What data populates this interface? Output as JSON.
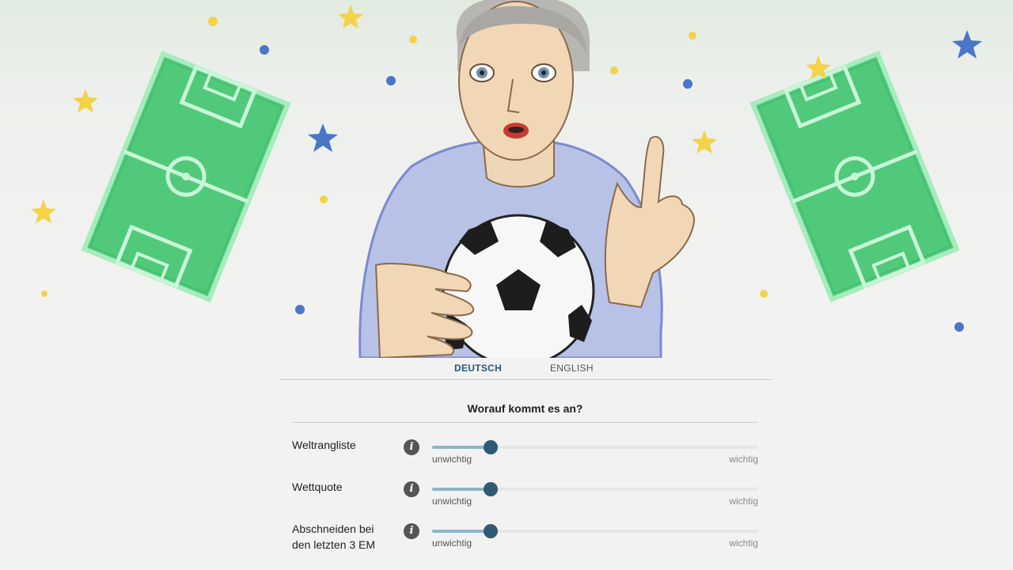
{
  "language_tabs": [
    {
      "label": "DEUTSCH",
      "active": true
    },
    {
      "label": "ENGLISH",
      "active": false
    }
  ],
  "section_title": "Worauf kommt es an?",
  "sliders": [
    {
      "label": "Weltrangliste",
      "value_fraction": 0.18,
      "min_label": "unwichtig",
      "max_label": "wichtig"
    },
    {
      "label": "Wettquote",
      "value_fraction": 0.18,
      "min_label": "unwichtig",
      "max_label": "wichtig"
    },
    {
      "label": "Abschneiden bei den letzten 3 EM",
      "value_fraction": 0.18,
      "min_label": "unwichtig",
      "max_label": "wichtig"
    }
  ],
  "colors": {
    "accent": "#2f5a74",
    "slider_fill": "#8fb4ca",
    "field_green": "#4cc776",
    "star_yellow": "#f4d24a",
    "star_blue": "#4a76c8"
  },
  "icons": {
    "info": "i"
  }
}
